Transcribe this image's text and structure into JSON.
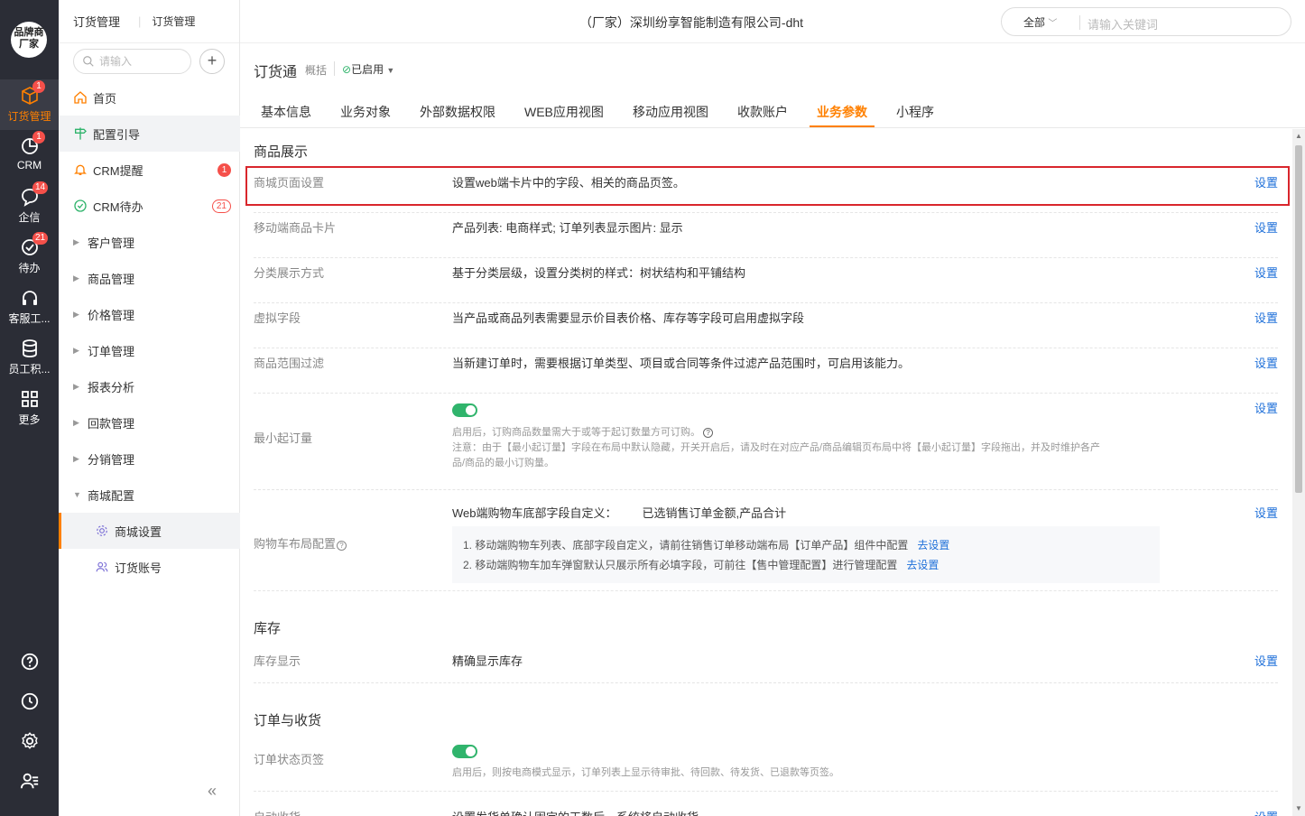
{
  "rail": {
    "brand": "品牌商厂家",
    "items": [
      {
        "label": "订货管理",
        "badge": "1",
        "icon": "cube-icon"
      },
      {
        "label": "CRM",
        "badge": "1",
        "icon": "pie-chart-icon"
      },
      {
        "label": "企信",
        "badge": "14",
        "icon": "chat-icon"
      },
      {
        "label": "待办",
        "badge": "21",
        "icon": "check-circle-icon"
      },
      {
        "label": "客服工...",
        "badge": "",
        "icon": "headset-icon"
      },
      {
        "label": "员工积...",
        "badge": "",
        "icon": "database-icon"
      },
      {
        "label": "更多",
        "badge": "",
        "icon": "grid-icon"
      }
    ],
    "bottom_icons": [
      "help-icon",
      "clock-icon",
      "settings-icon",
      "user-list-icon"
    ]
  },
  "sidebar": {
    "breadcrumb_1": "订货管理",
    "breadcrumb_2": "订货管理",
    "search_placeholder": "请输入",
    "add_label": "+",
    "items": [
      {
        "label": "首页",
        "badge": ""
      },
      {
        "label": "配置引导",
        "badge": ""
      },
      {
        "label": "CRM提醒",
        "badge": "1"
      },
      {
        "label": "CRM待办",
        "badge": "21"
      },
      {
        "label": "客户管理"
      },
      {
        "label": "商品管理"
      },
      {
        "label": "价格管理"
      },
      {
        "label": "订单管理"
      },
      {
        "label": "报表分析"
      },
      {
        "label": "回款管理"
      },
      {
        "label": "分销管理"
      },
      {
        "label": "商城配置"
      },
      {
        "label": "商城设置"
      },
      {
        "label": "订货账号"
      }
    ],
    "collapse": "«"
  },
  "topbar": {
    "title": "（厂家）深圳纷享智能制造有限公司-dht",
    "scope": "全部",
    "search_placeholder": "请输入关键词"
  },
  "app": {
    "title": "订货通",
    "sub": "概括",
    "status": "已启用"
  },
  "tabs": [
    "基本信息",
    "业务对象",
    "外部数据权限",
    "WEB应用视图",
    "移动应用视图",
    "收款账户",
    "业务参数",
    "小程序"
  ],
  "active_tab": "业务参数",
  "sections": {
    "goods": {
      "title": "商品展示",
      "rows": [
        {
          "label": "商城页面设置",
          "desc": "设置web端卡片中的字段、相关的商品页签。",
          "link": "设置"
        },
        {
          "label": "移动端商品卡片",
          "desc": "产品列表: 电商样式; 订单列表显示图片: 显示",
          "link": "设置"
        },
        {
          "label": "分类展示方式",
          "desc": "基于分类层级，设置分类树的样式：树状结构和平铺结构",
          "link": "设置"
        },
        {
          "label": "虚拟字段",
          "desc": "当产品或商品列表需要显示价目表价格、库存等字段可启用虚拟字段",
          "link": "设置"
        },
        {
          "label": "商品范围过滤",
          "desc": "当新建订单时，需要根据订单类型、项目或合同等条件过滤产品范围时，可启用该能力。",
          "link": "设置"
        }
      ],
      "min_order": {
        "label": "最小起订量",
        "note1": "启用后，订购商品数量需大于或等于起订数量方可订购。",
        "note2": "注意：由于【最小起订量】字段在布局中默认隐藏，开关开启后，请及时在对应产品/商品编辑页布局中将【最小起订量】字段拖出，并及时维护各产",
        "note3": "品/商品的最小订购量。",
        "link": "设置"
      },
      "cart": {
        "label": "购物车布局配置",
        "desc_label": "Web端购物车底部字段自定义：",
        "desc_value": "已选销售订单金额,产品合计",
        "line1": "1. 移动端购物车列表、底部字段自定义，请前往销售订单移动端布局【订单产品】组件中配置",
        "line2": "2. 移动端购物车加车弹窗默认只展示所有必填字段，可前往【售中管理配置】进行管理配置",
        "go": "去设置",
        "link": "设置"
      }
    },
    "stock": {
      "title": "库存",
      "label": "库存显示",
      "desc": "精确显示库存",
      "link": "设置"
    },
    "order": {
      "title": "订单与收货",
      "label": "订单状态页签",
      "note": "启用后，则按电商模式显示，订单列表上显示待审批、待回款、待发货、已退款等页签。",
      "label2": "自动收货",
      "desc2": "设置发货单确认固定的天数后，系统将自动收货",
      "link2": "设置"
    }
  },
  "colors": {
    "accent": "#ff8000",
    "link": "#1e6fd9",
    "badge": "#f5504a",
    "toggle": "#30b46c",
    "rail": "#2b2d36"
  }
}
